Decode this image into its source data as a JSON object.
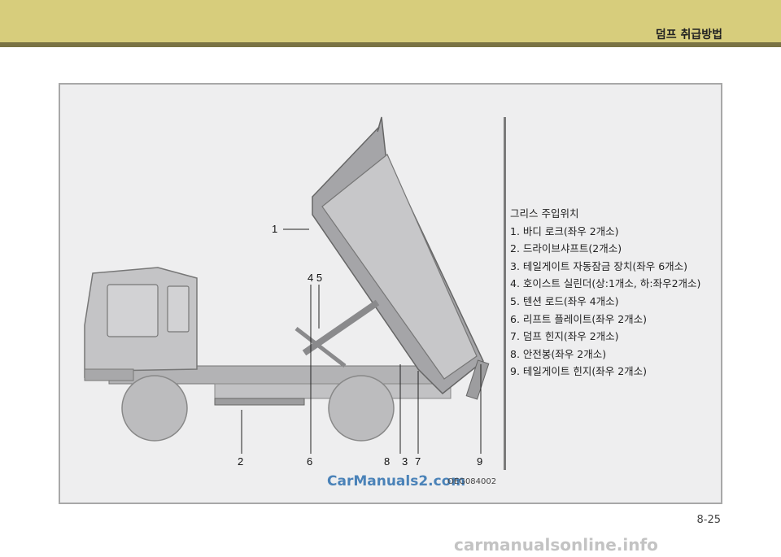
{
  "header": {
    "section_title": "덤프 취급방법"
  },
  "figure": {
    "callouts": [
      {
        "id": "c1",
        "label": "1"
      },
      {
        "id": "c2",
        "label": "2"
      },
      {
        "id": "c3",
        "label": "3"
      },
      {
        "id": "c45",
        "label": "4 5"
      },
      {
        "id": "c6",
        "label": "6"
      },
      {
        "id": "c7",
        "label": "7"
      },
      {
        "id": "c8",
        "label": "8"
      },
      {
        "id": "c9",
        "label": "9"
      }
    ],
    "image_code": "OEG084002",
    "watermark": "CarManuals2.com"
  },
  "legend": {
    "title": "그리스 주입위치",
    "items": [
      "1. 바디 로크(좌우 2개소)",
      "2. 드라이브샤프트(2개소)",
      "3. 테일게이트 자동잠금 장치(좌우 6개소)",
      "4. 호이스트 실린더(상:1개소, 하:좌우2개소)",
      "5. 텐션 로드(좌우 4개소)",
      "6. 리프트 플레이트(좌우 2개소)",
      "7. 덤프 힌지(좌우 2개소)",
      "8. 안전봉(좌우 2개소)",
      "9. 테일게이트 힌지(좌우 2개소)"
    ]
  },
  "footer": {
    "page_number": "8-25",
    "site_watermark": "carmanualsonline.info"
  },
  "colors": {
    "header_band": "#d7cd7c",
    "header_line": "#7a7344",
    "figure_bg": "#eeeeef",
    "truck_fill": "#b9b9bb",
    "watermark_blue": "#4a82b8"
  }
}
